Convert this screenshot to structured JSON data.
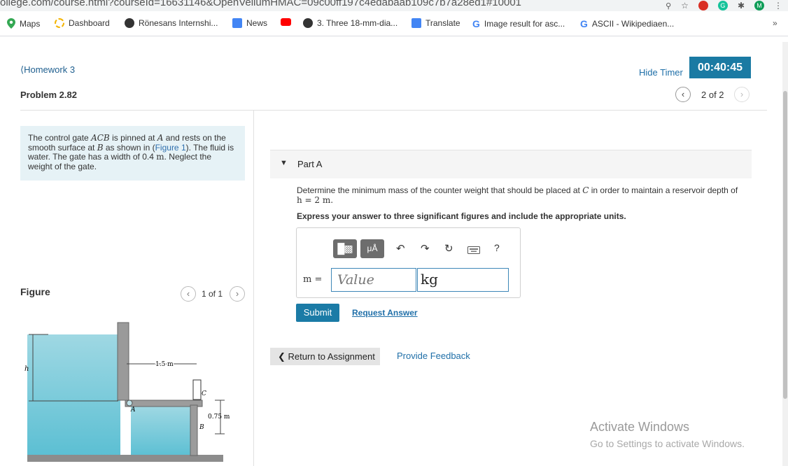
{
  "browser": {
    "url_fragment": "ollege.com/course.html?courseId=16631146&OpenVellumHMAC=09c00ff197c4edabaab109c7b7a28ed1#10001",
    "bookmarks": [
      {
        "label": "Maps",
        "icon": "maps-pin-icon",
        "color": "#34a853"
      },
      {
        "label": "Dashboard",
        "icon": "dashboard-ring-icon",
        "color": "#f4b400"
      },
      {
        "label": "Rönesans Internshi...",
        "icon": "globe-icon",
        "color": "#333333"
      },
      {
        "label": "News",
        "icon": "google-news-icon",
        "color": "#4285f4"
      },
      {
        "label": "",
        "icon": "youtube-icon",
        "color": "#ff0000"
      },
      {
        "label": "3. Three 18-mm-dia...",
        "icon": "globe-icon",
        "color": "#333333"
      },
      {
        "label": "Translate",
        "icon": "google-translate-icon",
        "color": "#4285f4"
      },
      {
        "label": "Image result for asc...",
        "icon": "google-g-icon",
        "color": "#4285f4"
      },
      {
        "label": "ASCII - Wikipediaen...",
        "icon": "google-g-icon",
        "color": "#4285f4"
      }
    ],
    "overflow_label": "»",
    "profile_initial": "M"
  },
  "header": {
    "back_link": "Homework 3",
    "problem_title": "Problem 2.82",
    "hide_timer": "Hide Timer",
    "timer": "00:40:45",
    "nav_position": "2 of 2"
  },
  "problem": {
    "text_1": "The control gate ",
    "var_acb": "ACB",
    "text_2": " is pinned at ",
    "var_a": "A",
    "text_3": " and rests on the smooth surface at ",
    "var_b": "B",
    "text_4": " as shown in (",
    "figure_link": "Figure 1",
    "text_5": "). The fluid is water. The gate has a width of 0.4 ",
    "unit_m": "m",
    "text_6": ". Neglect the weight of the gate."
  },
  "figure": {
    "label": "Figure",
    "position": "1 of 1",
    "dim_width": "1.5 m",
    "dim_height": "0.75 m",
    "label_h": "h",
    "label_a": "A",
    "label_b": "B",
    "label_c": "C"
  },
  "part": {
    "title": "Part A",
    "question_1": "Determine the minimum mass of the counter weight that should be placed at ",
    "var_c": "C",
    "question_2": " in order to maintain a reservoir depth of",
    "question_3": "h = 2 m.",
    "instruction": "Express your answer to three significant figures and include the appropriate units."
  },
  "answer": {
    "toolbar_templates": "templates",
    "toolbar_units": "μÅ",
    "help": "?",
    "variable_label": "m =",
    "value_placeholder": "Value",
    "units_value": "kg"
  },
  "actions": {
    "submit": "Submit",
    "request_answer": "Request Answer",
    "return": "Return to Assignment",
    "feedback": "Provide Feedback"
  },
  "watermark": {
    "title": "Activate Windows",
    "subtitle": "Go to Settings to activate Windows."
  }
}
